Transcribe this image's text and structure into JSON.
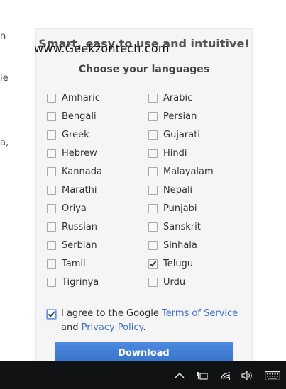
{
  "left_fragments": [
    "n",
    "le",
    "a,"
  ],
  "card": {
    "headline": "Smart, easy to use and intuitive!",
    "watermark": "www.Geekzontech.com",
    "section_title": "Choose your languages"
  },
  "languages": {
    "left": [
      {
        "label": "Amharic",
        "checked": false
      },
      {
        "label": "Bengali",
        "checked": false
      },
      {
        "label": "Greek",
        "checked": false
      },
      {
        "label": "Hebrew",
        "checked": false
      },
      {
        "label": "Kannada",
        "checked": false
      },
      {
        "label": "Marathi",
        "checked": false
      },
      {
        "label": "Oriya",
        "checked": false
      },
      {
        "label": "Russian",
        "checked": false
      },
      {
        "label": "Serbian",
        "checked": false
      },
      {
        "label": "Tamil",
        "checked": false
      },
      {
        "label": "Tigrinya",
        "checked": false
      }
    ],
    "right": [
      {
        "label": "Arabic",
        "checked": false
      },
      {
        "label": "Persian",
        "checked": false
      },
      {
        "label": "Gujarati",
        "checked": false
      },
      {
        "label": "Hindi",
        "checked": false
      },
      {
        "label": "Malayalam",
        "checked": false
      },
      {
        "label": "Nepali",
        "checked": false
      },
      {
        "label": "Punjabi",
        "checked": false
      },
      {
        "label": "Sanskrit",
        "checked": false
      },
      {
        "label": "Sinhala",
        "checked": false
      },
      {
        "label": "Telugu",
        "checked": true
      },
      {
        "label": "Urdu",
        "checked": false
      }
    ]
  },
  "agreement": {
    "checked": true,
    "prefix": "I agree to the Google ",
    "tos_link": "Terms of Service",
    "middle": " and ",
    "privacy_link": "Privacy Policy",
    "suffix": "."
  },
  "download_label": "Download",
  "taskbar": {
    "icons": [
      "chevron-up-icon",
      "power-icon",
      "wifi-icon",
      "volume-icon",
      "keyboard-icon"
    ]
  }
}
